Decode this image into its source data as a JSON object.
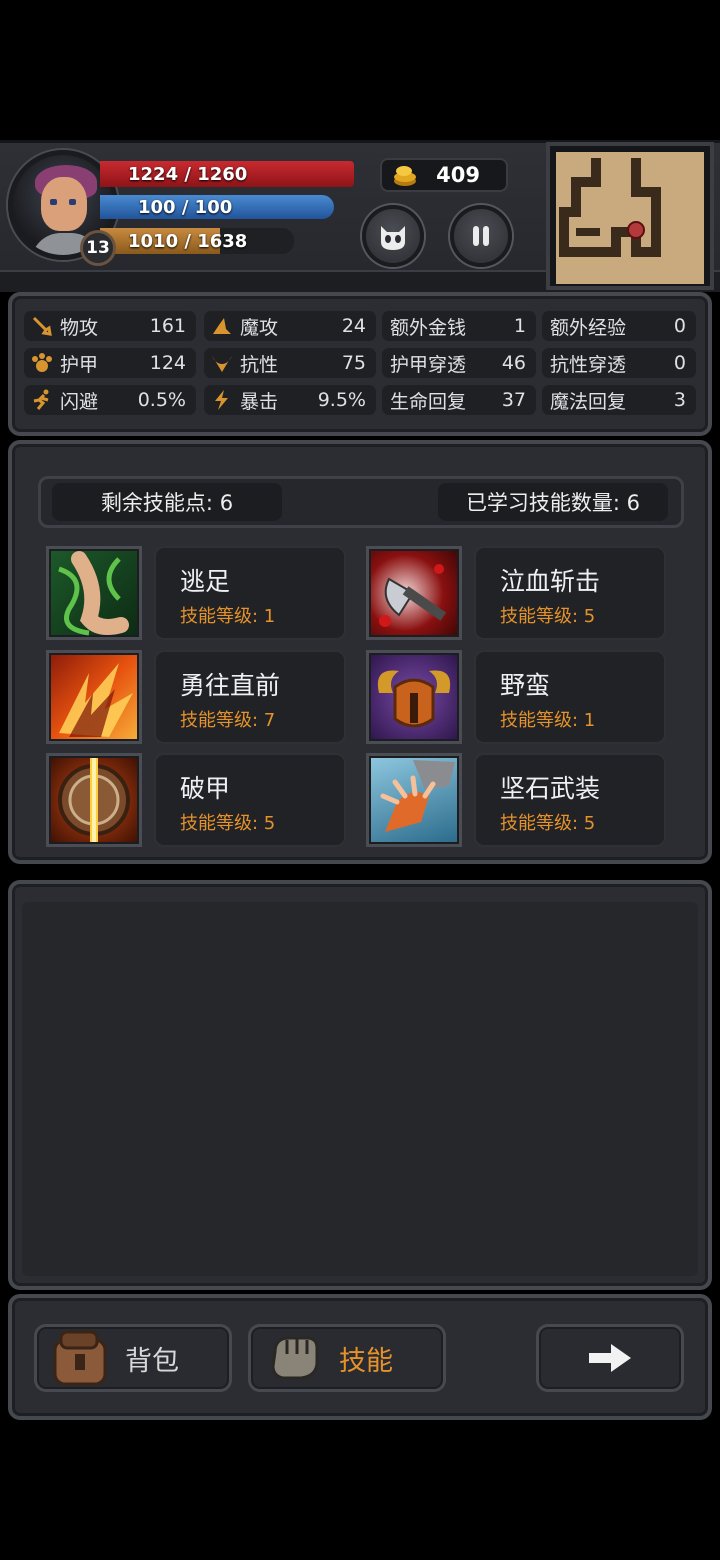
{
  "player": {
    "level": "13",
    "hp": "1224 / 1260",
    "mp": "100 / 100",
    "xp": "1010 / 1638",
    "xp_fraction": 0.6166,
    "gold": "409"
  },
  "stats": [
    [
      {
        "icon": "sword-icon",
        "label": "物攻",
        "value": "161"
      },
      {
        "icon": "magic-hat-icon",
        "label": "魔攻",
        "value": "24"
      },
      {
        "label": "额外金钱",
        "value": "1"
      },
      {
        "label": "额外经验",
        "value": "0"
      }
    ],
    [
      {
        "icon": "paw-armor-icon",
        "label": "护甲",
        "value": "124"
      },
      {
        "icon": "resistance-icon",
        "label": "抗性",
        "value": "75"
      },
      {
        "label": "护甲穿透",
        "value": "46"
      },
      {
        "label": "抗性穿透",
        "value": "0"
      }
    ],
    [
      {
        "icon": "running-icon",
        "label": "闪避",
        "value": "0.5%"
      },
      {
        "icon": "lightning-icon",
        "label": "暴击",
        "value": "9.5%"
      },
      {
        "label": "生命回复",
        "value": "37"
      },
      {
        "label": "魔法回复",
        "value": "3"
      }
    ]
  ],
  "skills_header": {
    "remaining": "剩余技能点: 6",
    "learned": "已学习技能数量: 6"
  },
  "skills": [
    {
      "name": "逃足",
      "level": "技能等级: 1",
      "icon": "vine-foot-icon"
    },
    {
      "name": "泣血斩击",
      "level": "技能等级: 5",
      "icon": "blood-axe-icon"
    },
    {
      "name": "勇往直前",
      "level": "技能等级: 7",
      "icon": "fire-charge-icon"
    },
    {
      "name": "野蛮",
      "level": "技能等级: 1",
      "icon": "horned-helmet-icon"
    },
    {
      "name": "破甲",
      "level": "技能等级: 5",
      "icon": "broken-shield-icon"
    },
    {
      "name": "坚石武装",
      "level": "技能等级: 5",
      "icon": "stone-claw-icon"
    }
  ],
  "bottom_tabs": {
    "bag": "背包",
    "skills": "技能"
  },
  "colors": {
    "accent_orange": "#e5922a",
    "hp_red": "#c82a2f",
    "mp_blue": "#3c79c4",
    "xp_orange": "#b87a34"
  }
}
